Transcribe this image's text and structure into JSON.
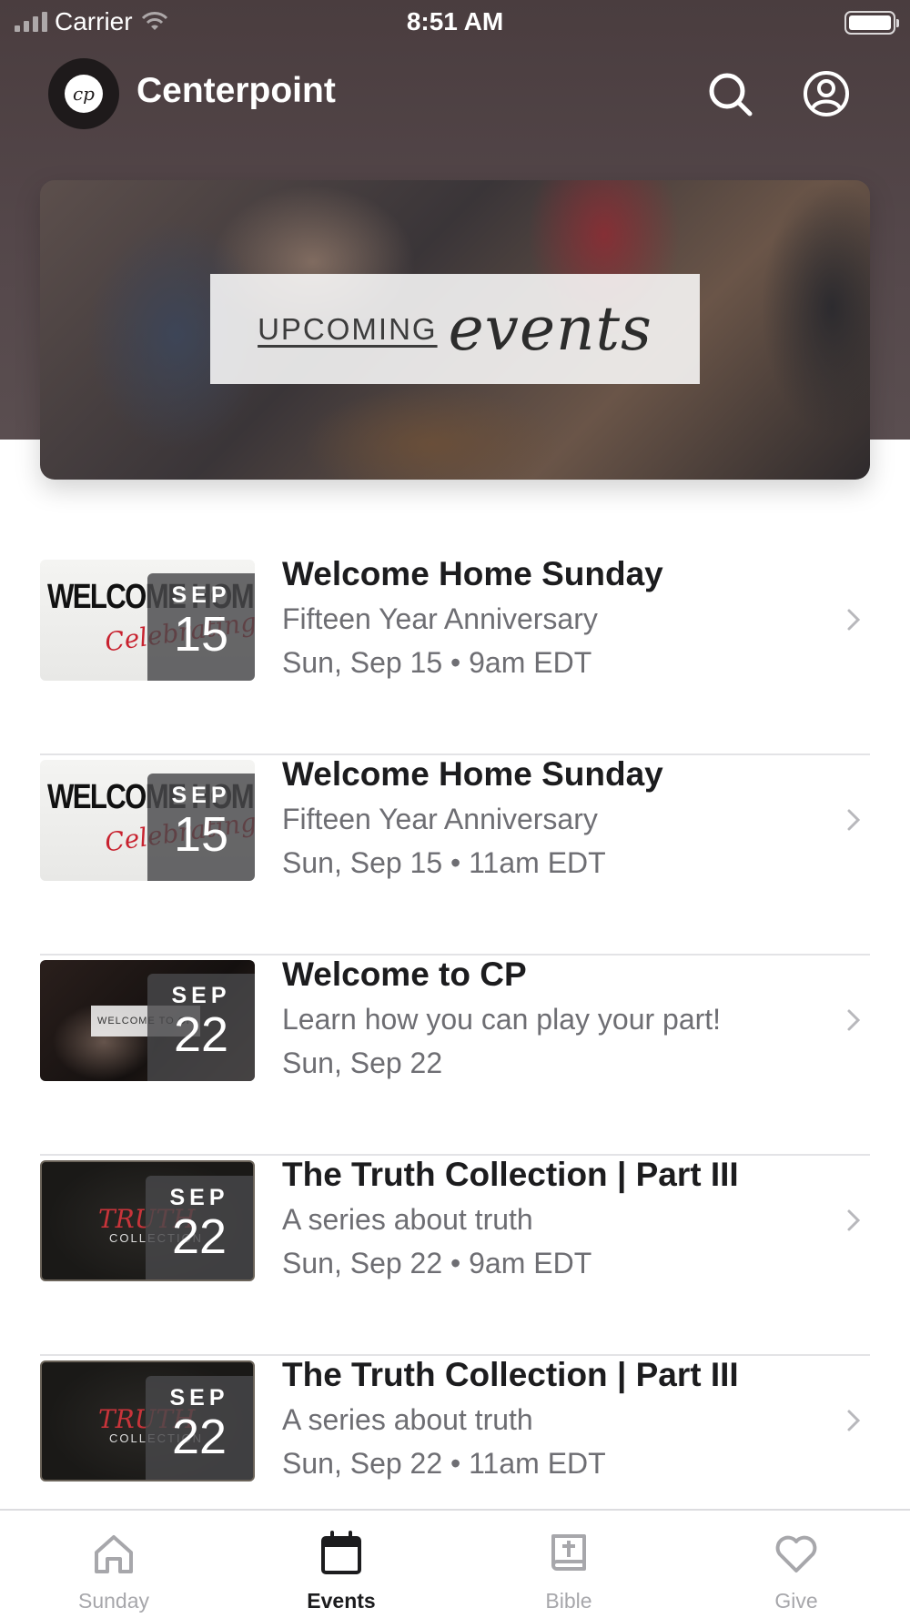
{
  "status_bar": {
    "carrier": "Carrier",
    "time": "8:51 AM"
  },
  "header": {
    "logo_text": "cp",
    "title": "Centerpoint",
    "icons": [
      "search-icon",
      "profile-icon"
    ]
  },
  "hero": {
    "banner_word": "UPCOMING",
    "banner_script": "events"
  },
  "events": [
    {
      "title": "Welcome Home Sunday",
      "subtitle": "Fifteen Year Anniversary",
      "date": "Sun, Sep 15 • 9am EDT",
      "badge_month": "SEP",
      "badge_day": "15",
      "thumb_style": "welcome",
      "thumb_text": "WELCOME HOME",
      "thumb_script": "Celebrating 15 Years"
    },
    {
      "title": "Welcome Home Sunday",
      "subtitle": "Fifteen Year Anniversary",
      "date": "Sun, Sep 15 • 11am EDT",
      "badge_month": "SEP",
      "badge_day": "15",
      "thumb_style": "welcome",
      "thumb_text": "WELCOME HOME",
      "thumb_script": "Celebrating 15 Years"
    },
    {
      "title": "Welcome to CP",
      "subtitle": "Learn how you can play your part!",
      "date": "Sun, Sep 22",
      "badge_month": "SEP",
      "badge_day": "22",
      "thumb_style": "cp",
      "thumb_text": "WELCOME TO CP",
      "thumb_script": ""
    },
    {
      "title": "The Truth Collection | Part III",
      "subtitle": "A series about truth",
      "date": "Sun, Sep 22 • 9am EDT",
      "badge_month": "SEP",
      "badge_day": "22",
      "thumb_style": "truth",
      "thumb_text": "TRUTH",
      "thumb_script": "COLLECTION"
    },
    {
      "title": "The Truth Collection | Part III",
      "subtitle": "A series about truth",
      "date": "Sun, Sep 22 • 11am EDT",
      "badge_month": "SEP",
      "badge_day": "22",
      "thumb_style": "truth",
      "thumb_text": "TRUTH",
      "thumb_script": "COLLECTION"
    }
  ],
  "tabs": [
    {
      "label": "Sunday",
      "icon": "home-icon",
      "active": false
    },
    {
      "label": "Events",
      "icon": "calendar-icon",
      "active": true
    },
    {
      "label": "Bible",
      "icon": "bible-icon",
      "active": false
    },
    {
      "label": "Give",
      "icon": "heart-icon",
      "active": false
    }
  ],
  "colors": {
    "header_bg": "#4a3d3f",
    "text_primary": "#1c1c1e",
    "text_secondary": "#6e6e73",
    "tab_inactive": "#a7a7ab",
    "divider": "#e3e3e6"
  }
}
